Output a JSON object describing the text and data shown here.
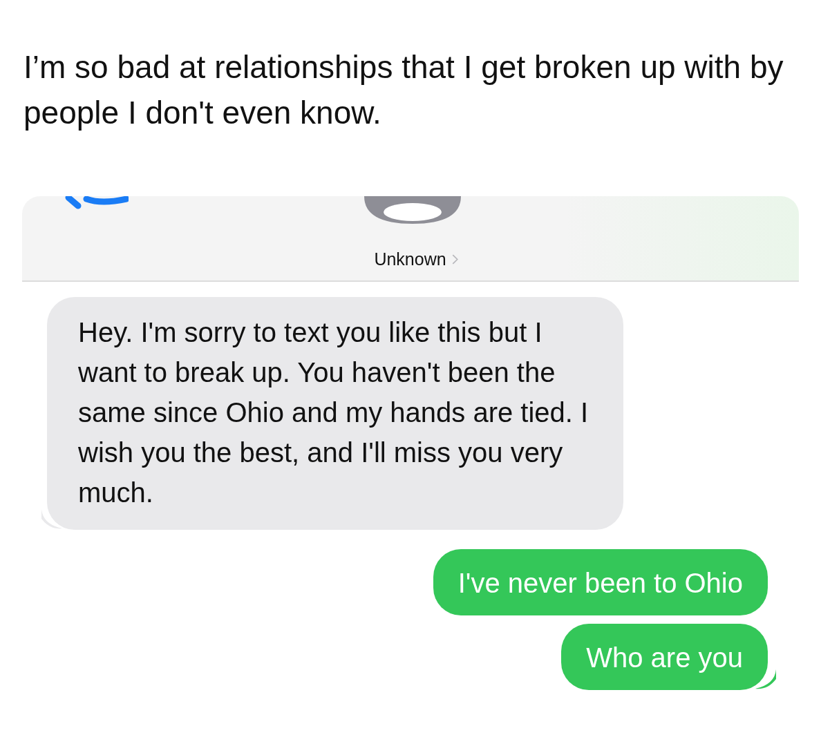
{
  "post": {
    "text": "I’m so bad at relationships that I get broken up with by people I don't even know."
  },
  "conversation": {
    "contact": {
      "name": "Unknown"
    },
    "messages": [
      {
        "kind": "received",
        "tail": true,
        "text": "Hey. I'm sorry to text you like this but I want to break up. You haven't been the same since Ohio and my hands are tied. I wish you the best, and I'll miss you very much."
      },
      {
        "kind": "sent",
        "tail": false,
        "text": "I've never been to Ohio"
      },
      {
        "kind": "sent",
        "tail": true,
        "text": "Who are you"
      }
    ]
  }
}
